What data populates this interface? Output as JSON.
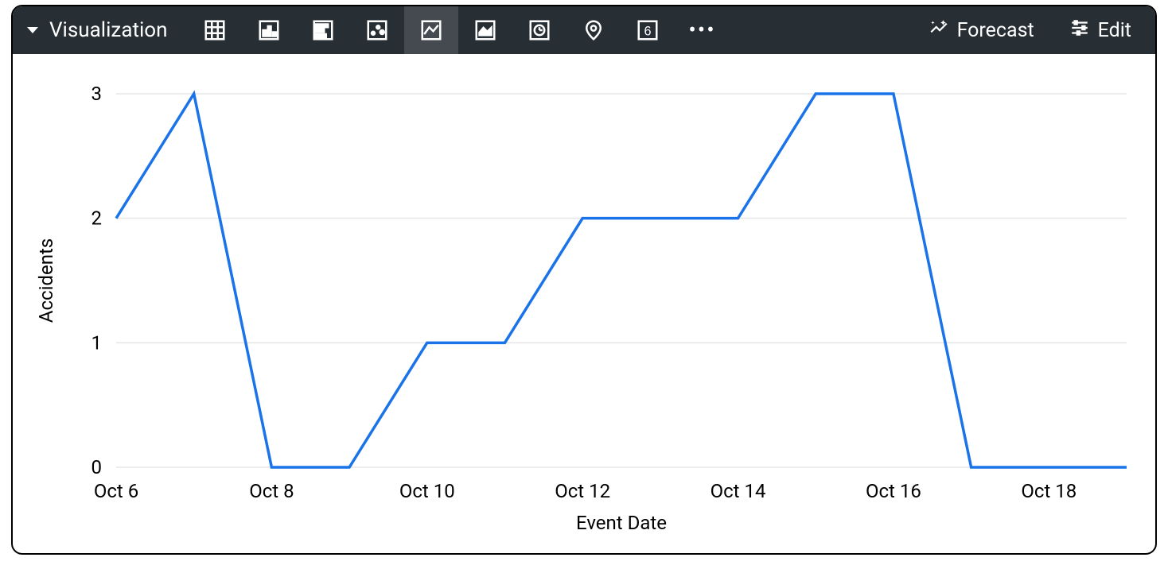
{
  "toolbar": {
    "title": "Visualization",
    "icons": [
      {
        "name": "table-icon",
        "selected": false
      },
      {
        "name": "column-chart-icon",
        "selected": false
      },
      {
        "name": "bar-chart-icon",
        "selected": false
      },
      {
        "name": "scatter-chart-icon",
        "selected": false
      },
      {
        "name": "line-chart-icon",
        "selected": true
      },
      {
        "name": "area-chart-icon",
        "selected": false
      },
      {
        "name": "timechart-icon",
        "selected": false
      },
      {
        "name": "map-icon",
        "selected": false
      },
      {
        "name": "single-value-icon",
        "selected": false
      },
      {
        "name": "more-icon",
        "selected": false
      }
    ],
    "forecast_label": "Forecast",
    "edit_label": "Edit"
  },
  "chart_data": {
    "type": "line",
    "xlabel": "Event Date",
    "ylabel": "Accidents",
    "ylim": [
      0,
      3
    ],
    "y_ticks": [
      0,
      1,
      2,
      3
    ],
    "x_tick_labels": [
      "Oct 6",
      "Oct 8",
      "Oct 10",
      "Oct 12",
      "Oct 14",
      "Oct 16",
      "Oct 18"
    ],
    "x_tick_positions": [
      0,
      2,
      4,
      6,
      8,
      10,
      12
    ],
    "series": [
      {
        "name": "Accidents",
        "color": "#1a73e8",
        "x": [
          0,
          1,
          2,
          3,
          4,
          5,
          6,
          7,
          8,
          9,
          10,
          11,
          12,
          13
        ],
        "values": [
          2,
          3,
          0,
          0,
          1,
          1,
          2,
          2,
          2,
          3,
          3,
          0,
          0,
          0
        ]
      }
    ]
  }
}
